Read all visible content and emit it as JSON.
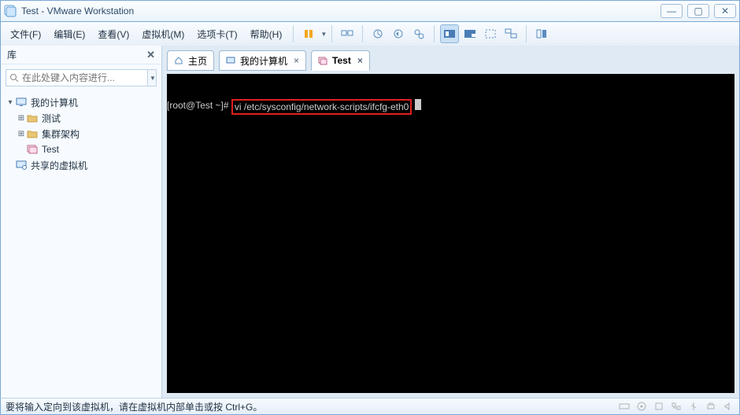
{
  "window": {
    "title": "Test - VMware Workstation"
  },
  "menus": {
    "file": "文件(F)",
    "edit": "编辑(E)",
    "view": "查看(V)",
    "vm": "虚拟机(M)",
    "tabs": "选项卡(T)",
    "help": "帮助(H)"
  },
  "sidebar": {
    "title": "库",
    "search_placeholder": "在此处键入内容进行...",
    "root": "我的计算机",
    "items": [
      "测试",
      "集群架构",
      "Test"
    ],
    "shared": "共享的虚拟机"
  },
  "tabs": {
    "home": "主页",
    "mycomputer": "我的计算机",
    "test": "Test"
  },
  "terminal": {
    "prompt": "[root@Test ~]# ",
    "command": "vi /etc/sysconfig/network-scripts/ifcfg-eth0"
  },
  "status": {
    "text": "要将输入定向到该虚拟机，请在虚拟机内部单击或按 Ctrl+G。"
  }
}
